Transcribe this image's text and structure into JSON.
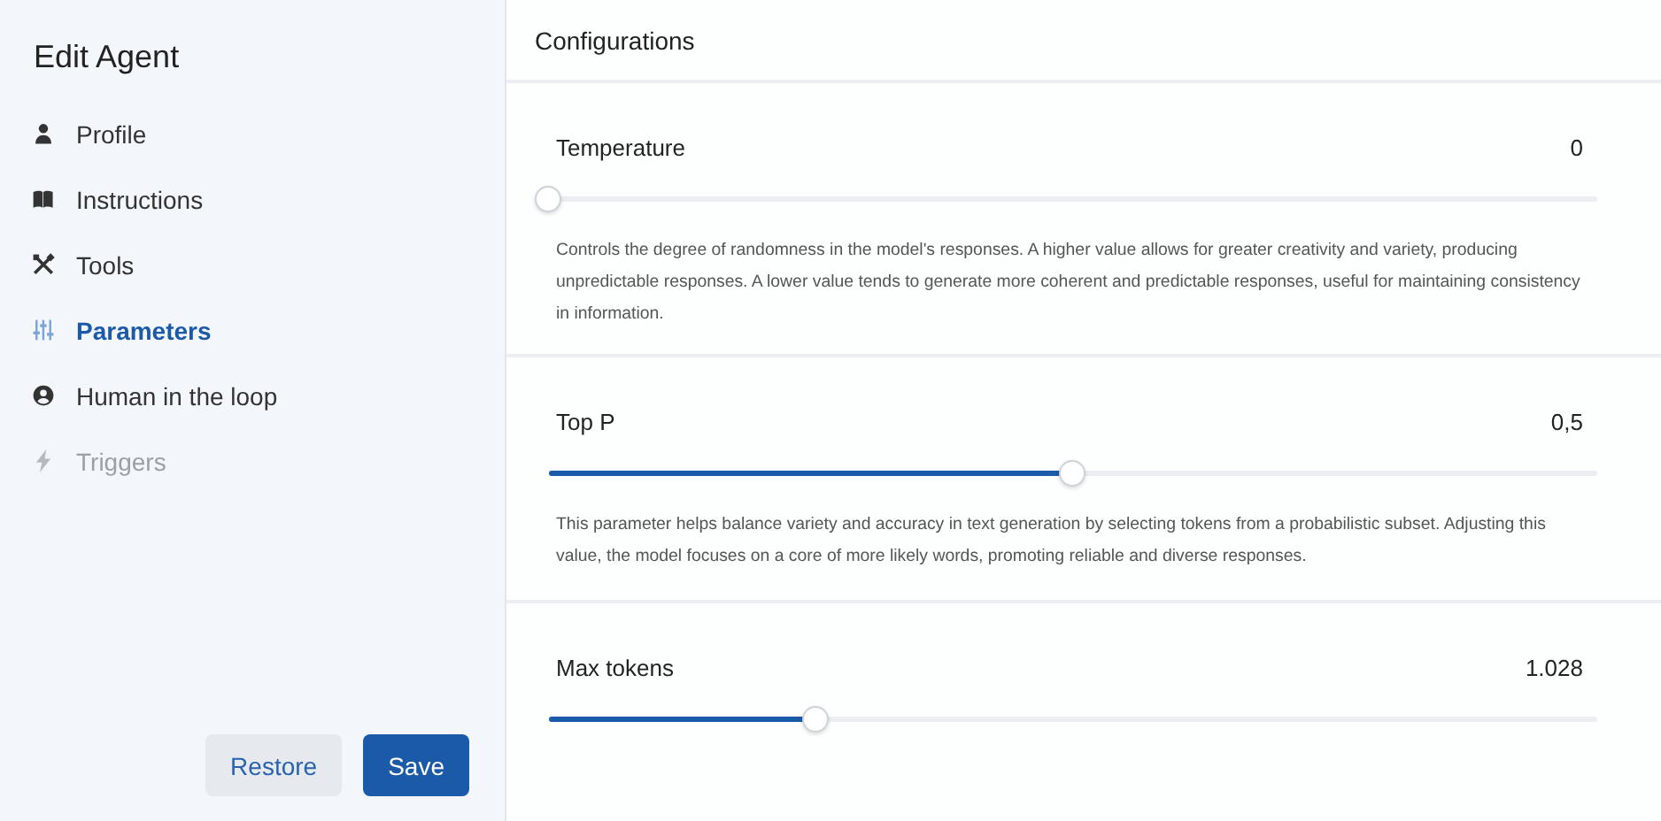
{
  "sidebar": {
    "title": "Edit Agent",
    "items": [
      {
        "label": "Profile",
        "selected": false,
        "disabled": false
      },
      {
        "label": "Instructions",
        "selected": false,
        "disabled": false
      },
      {
        "label": "Tools",
        "selected": false,
        "disabled": false
      },
      {
        "label": "Parameters",
        "selected": true,
        "disabled": false
      },
      {
        "label": "Human in the loop",
        "selected": false,
        "disabled": false
      },
      {
        "label": "Triggers",
        "selected": false,
        "disabled": true
      }
    ],
    "buttons": [
      {
        "label": "Restore",
        "kind": "secondary"
      },
      {
        "label": "Save",
        "kind": "primary"
      }
    ]
  },
  "main": {
    "title": "Configurations",
    "parameters": [
      {
        "name": "Temperature",
        "reading": "0",
        "level": 0,
        "description": "Controls the degree of randomness in the model's responses. A higher value allows for greater creativity and variety, producing unpredictable responses. A lower value tends to generate more coherent and predictable responses, useful for maintaining consistency in information."
      },
      {
        "name": "Top P",
        "reading": "0,5",
        "level": 0.5,
        "description": "This parameter helps balance variety and accuracy in text generation by selecting tokens from a probabilistic subset. Adjusting this value, the model focuses on a core of more likely words, promoting reliable and diverse responses."
      },
      {
        "name": "Max tokens",
        "reading": "1.028",
        "level": 0.255
      }
    ]
  }
}
